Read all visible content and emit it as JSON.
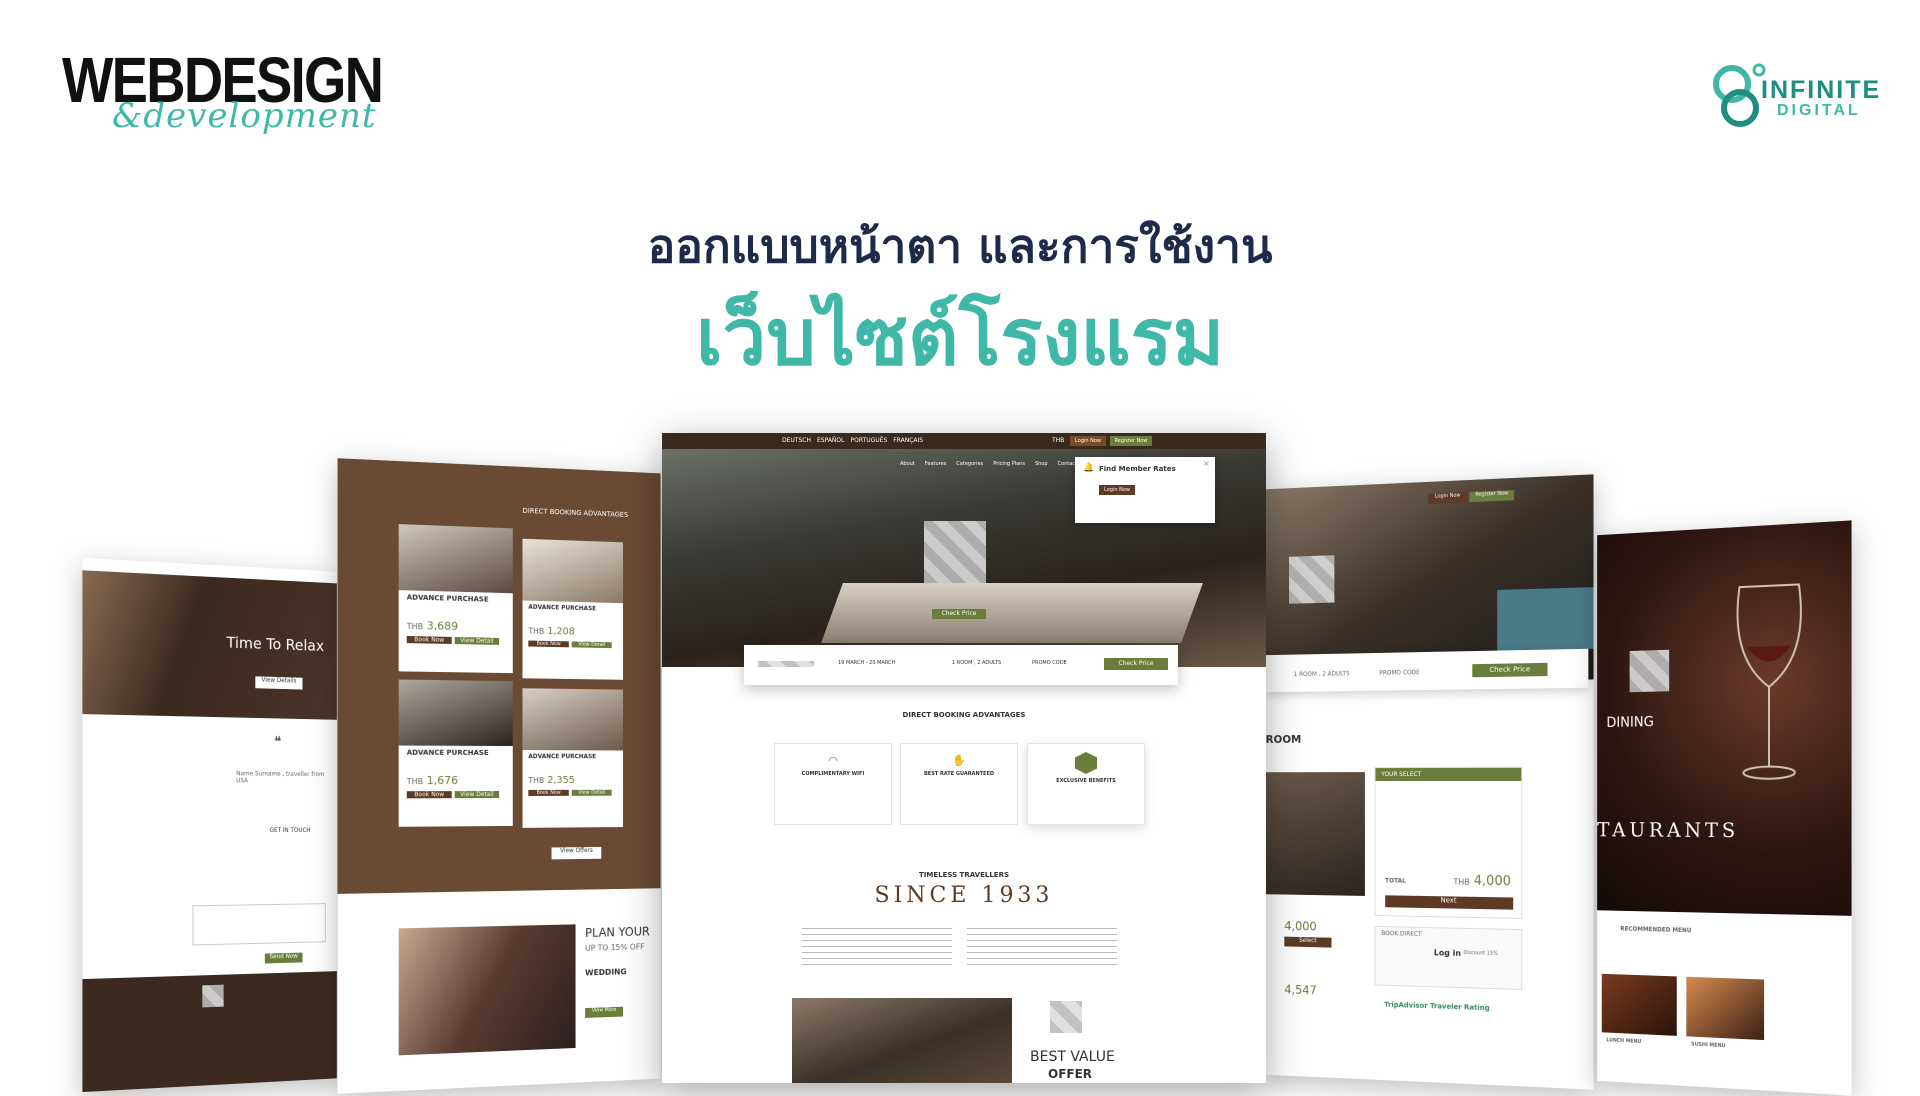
{
  "logo_left": {
    "main": "WEBDESIGN",
    "script": "&development"
  },
  "logo_right": {
    "line1": "INFINITE",
    "line2": "DIGITAL"
  },
  "headline": "ออกแบบหน้าตา และการใช้งาน",
  "subheadline": "เว็บไซต์โรงแรม",
  "screen1": {
    "title": "Time To Relax",
    "btn": "View Details",
    "author": "Name Surname , traveller from USA",
    "section": "GET IN TOUCH",
    "send": "Send Now"
  },
  "screen2": {
    "heading": "DIRECT BOOKING ADVANTAGES",
    "cards": [
      {
        "title": "ADVANCE PURCHASE",
        "price": "3,689",
        "currency": "THB",
        "book": "Book Now",
        "detail": "View Detail"
      },
      {
        "title": "ADVANCE PURCHASE",
        "price": "1,208",
        "currency": "THB",
        "book": "Book Now",
        "detail": "View Detail"
      },
      {
        "title": "ADVANCE PURCHASE",
        "price": "1,676",
        "currency": "THB",
        "book": "Book Now",
        "detail": "View Detail"
      },
      {
        "title": "ADVANCE PURCHASE",
        "price": "2,355",
        "currency": "THB",
        "book": "Book Now",
        "detail": "View Detail"
      }
    ],
    "view_offers": "View Offers",
    "plan_title": "PLAN YOUR",
    "plan_sub": "UP TO 15% OFF",
    "wedding": "WEDDING",
    "view_more": "View More"
  },
  "screen3": {
    "languages": [
      "DEUTSCH",
      "ESPAÑOL",
      "PORTUGUÊS",
      "FRANÇAIS"
    ],
    "currency": "THB",
    "login": "Login Now",
    "register": "Register Now",
    "nav": [
      "About",
      "Features",
      "Categories",
      "Pricing Plans",
      "Shop",
      "Contact"
    ],
    "popup_title": "Find Member Rates",
    "popup_btn": "Login Now",
    "hero_btn": "Check Price",
    "date_range": "19 MARCH - 20 MARCH",
    "guests": "1 ROOM , 2 ADULTS",
    "promo": "PROMO CODE",
    "check_price": "Check Price",
    "adv_heading": "DIRECT BOOKING ADVANTAGES",
    "features": [
      "COMPLIMENTARY WIFI",
      "BEST RATE GUARANTEED",
      "EXCLUSIVE BENEFITS"
    ],
    "timeless": "TIMELESS TRAVELLERS",
    "since": "SINCE 1933",
    "best_value": "BEST VALUE",
    "offer": "OFFER"
  },
  "screen4": {
    "guests": "1 ROOM , 2 ADULTS",
    "promo": "PROMO CODE",
    "check_price": "Check Price",
    "login": "Login Now",
    "register": "Register Now",
    "room_heading": "ROOM",
    "your_select": "YOUR SELECT",
    "total_label": "TOTAL",
    "currency": "THB",
    "total": "4,000",
    "next": "Next",
    "price1": "4,000",
    "price2": "4,547",
    "select": "Select",
    "book_direct": "BOOK DIRECT",
    "login_text": "Log in",
    "discount": "Discount 15%",
    "trip": "TripAdvisor Traveler Rating"
  },
  "screen5": {
    "dining": "DINING",
    "restaurants": "TAURANTS",
    "recommended": "RECOMMENDED MENU",
    "menu1": "LUNCH MENU",
    "menu2": "SUSHI MENU"
  }
}
